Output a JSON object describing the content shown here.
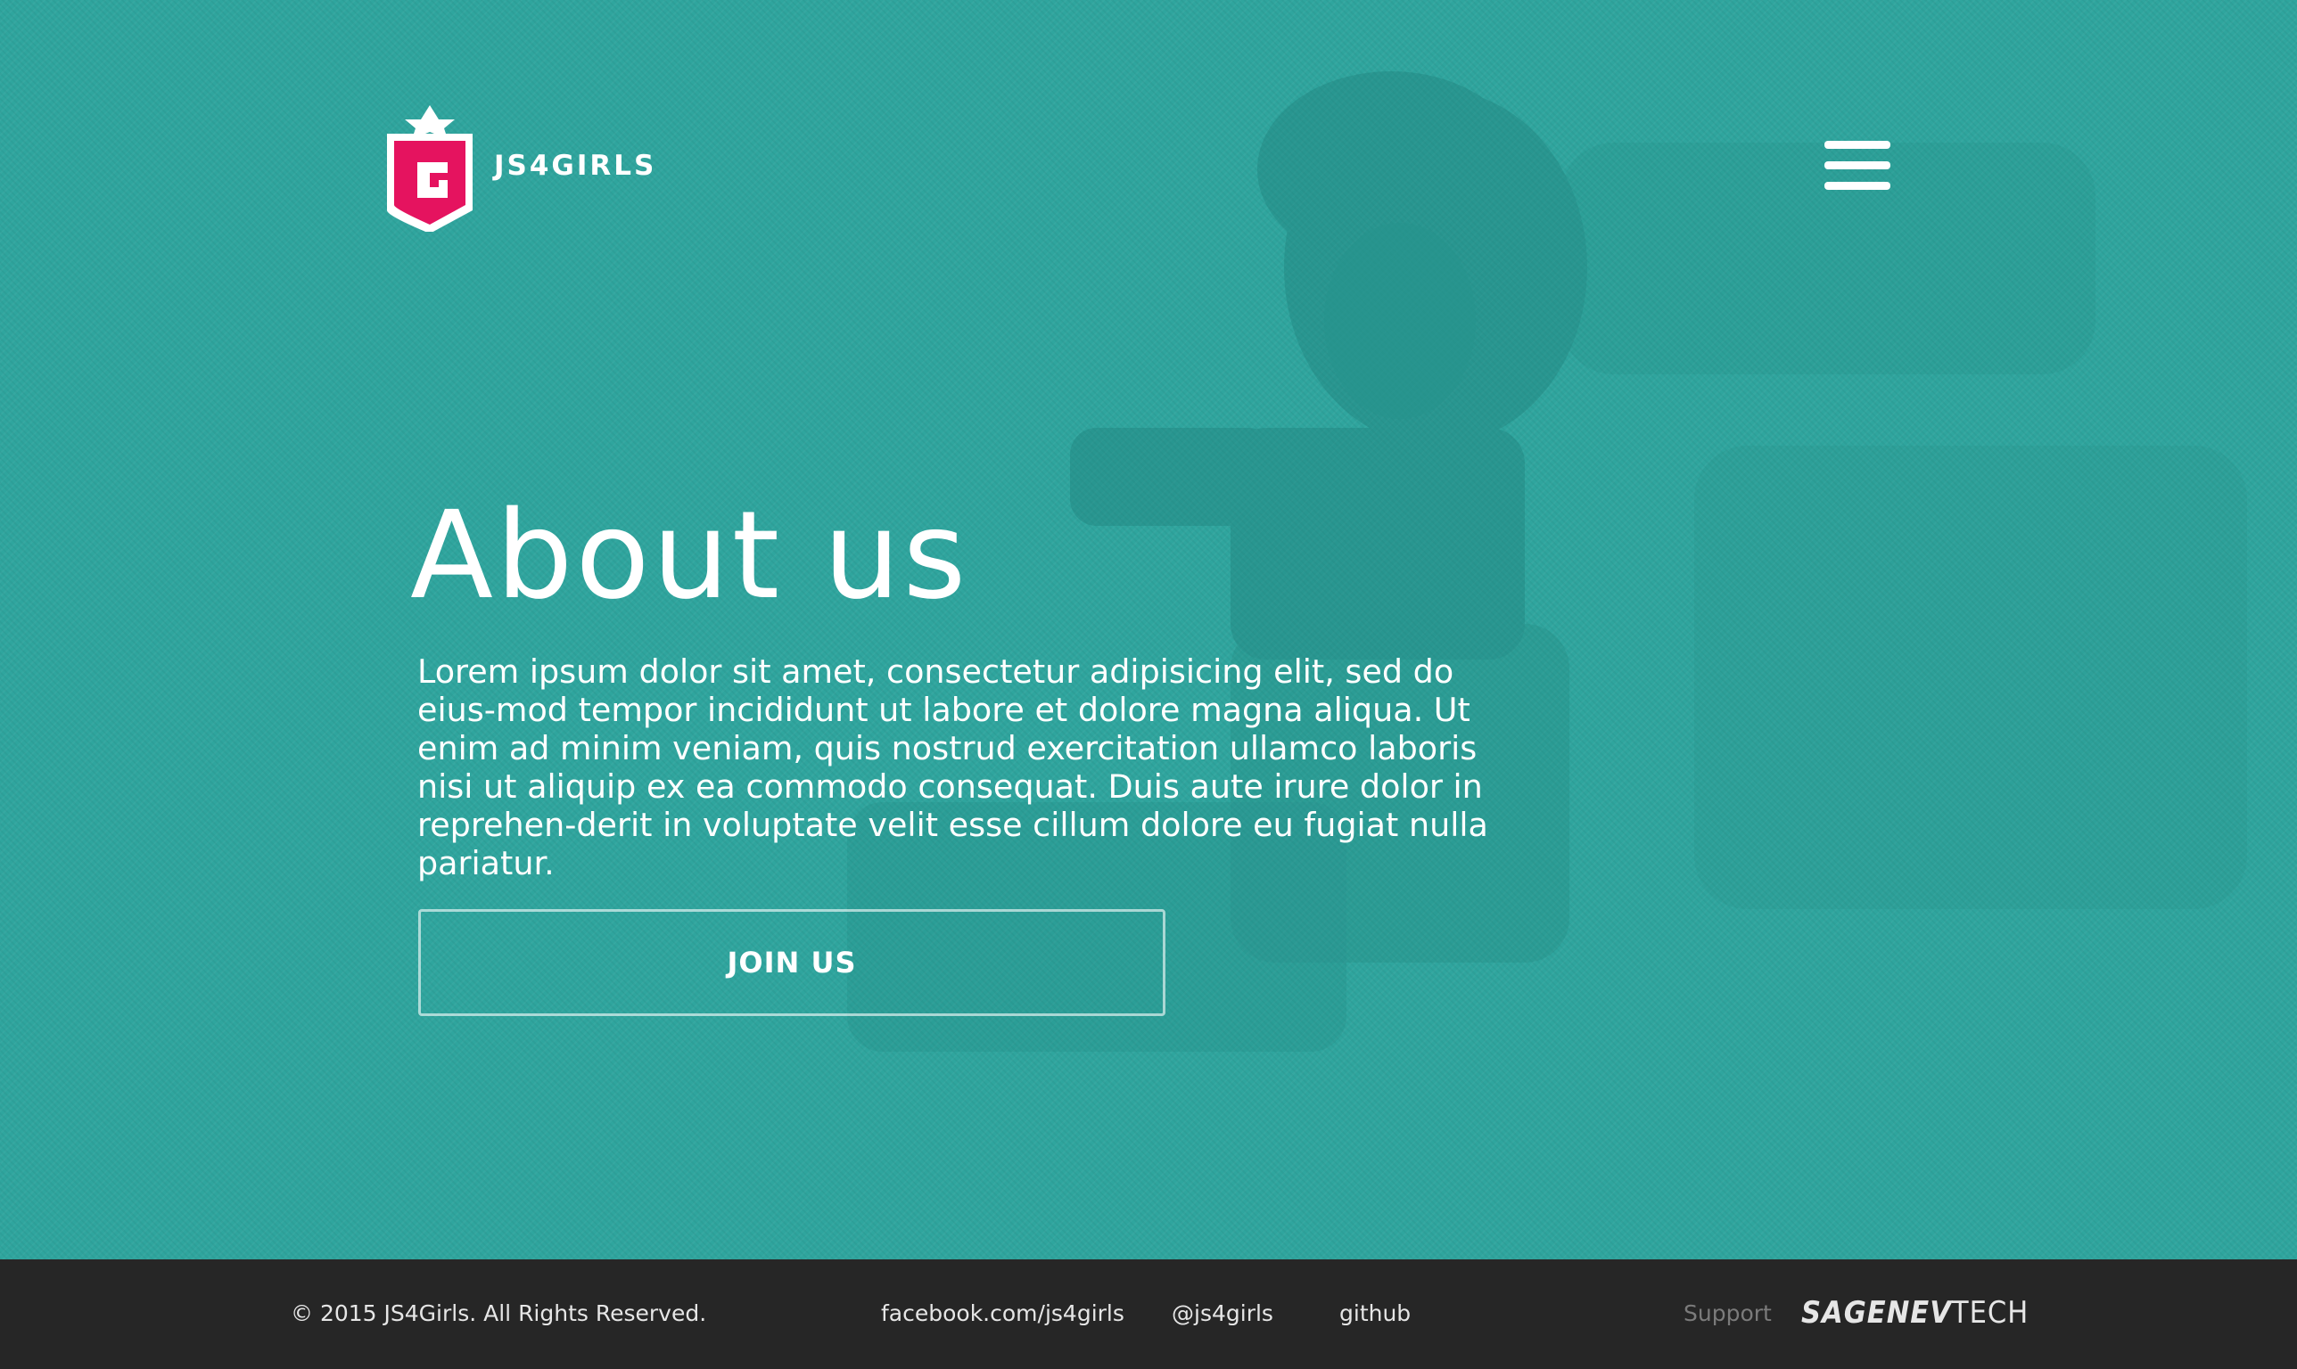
{
  "brand": {
    "name": "JS4GIRLS",
    "logo_letter": "G",
    "accent": "#e5135f"
  },
  "nav": {
    "menu_icon": "hamburger-menu-icon"
  },
  "hero": {
    "title": "About us",
    "description": "Lorem ipsum dolor sit amet, consectetur adipisicing elit, sed do eius-mod tempor incididunt ut labore et dolore magna aliqua. Ut enim ad minim veniam, quis nostrud exercitation ullamco laboris nisi ut aliquip ex ea commodo consequat. Duis aute irure dolor in reprehen-derit in voluptate velit esse cillum dolore eu fugiat nulla pariatur.",
    "cta_label": "JOIN US",
    "background_color": "#2fa59e"
  },
  "footer": {
    "copyright": "© 2015 JS4Girls. All Rights Reserved.",
    "links": {
      "facebook": "facebook.com/js4girls",
      "twitter": "@js4girls",
      "github": "github"
    },
    "support_label": "Support",
    "sponsor_bold": "SAGENEV",
    "sponsor_light": "TECH",
    "background_color": "#262626"
  }
}
